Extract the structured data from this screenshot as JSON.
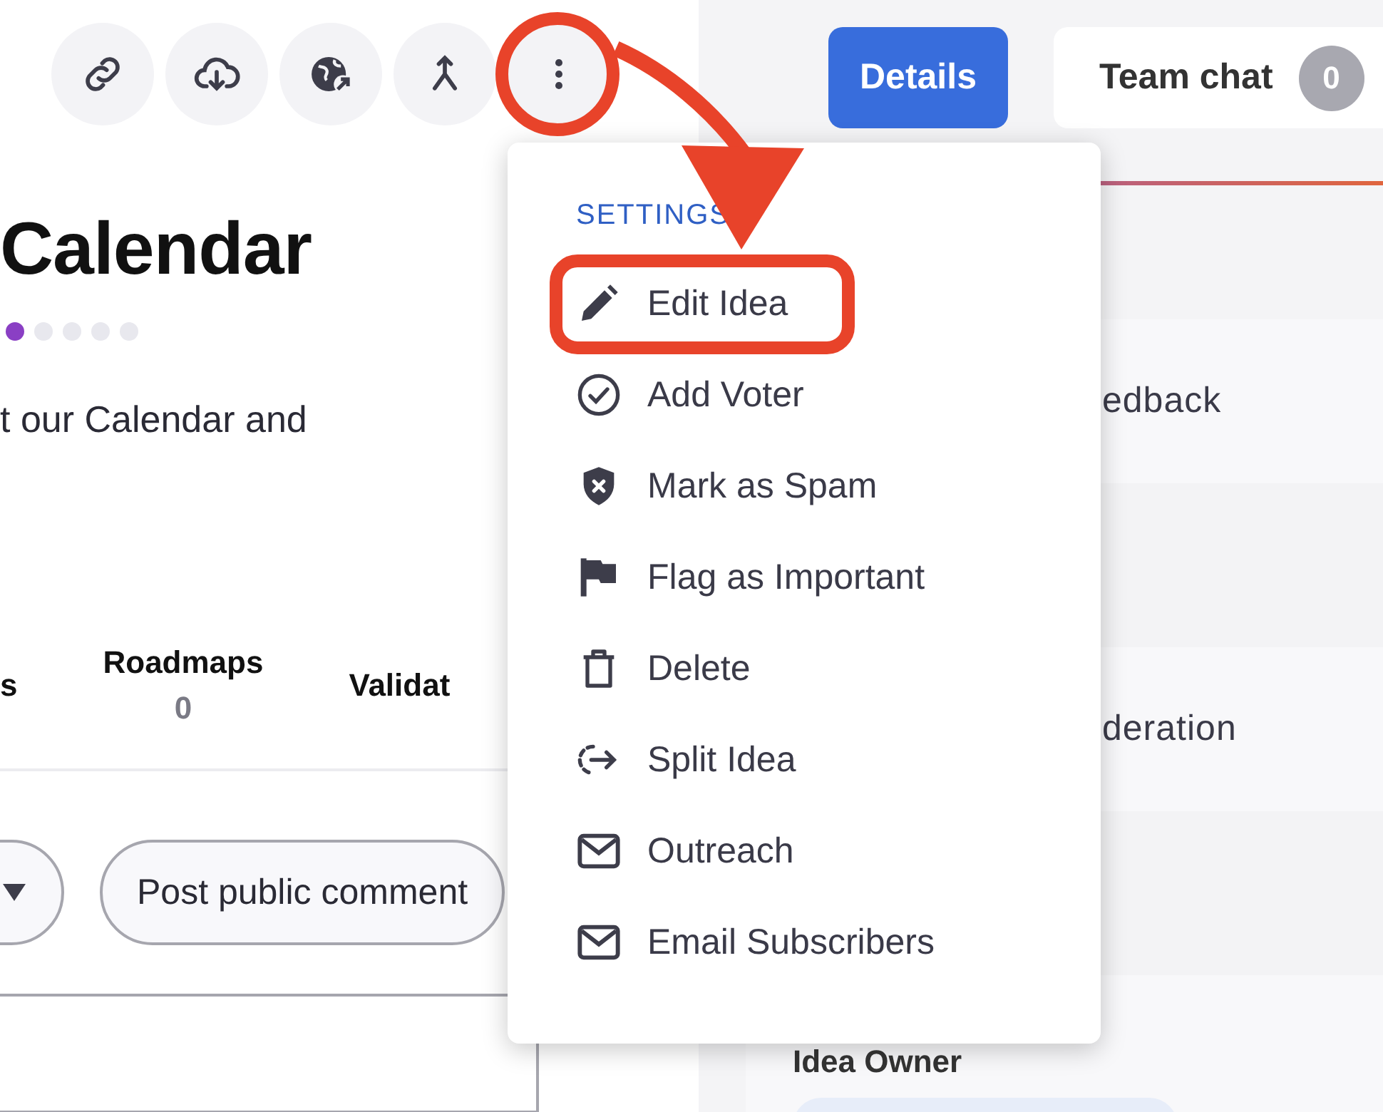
{
  "idea": {
    "title": "Calendar",
    "progress_dots": [
      {
        "filled": true
      },
      {
        "filled": false
      },
      {
        "filled": false
      },
      {
        "filled": false
      },
      {
        "filled": false
      }
    ],
    "description": "t our Calendar and",
    "stats": [
      {
        "label": "s"
      },
      {
        "label": "Roadmaps",
        "value": "0"
      },
      {
        "label": "Validat"
      }
    ],
    "comment_button": "Post public comment"
  },
  "tabs": [
    {
      "label": "Details",
      "selected": true
    },
    {
      "label": "Team chat",
      "selected": false,
      "count": "0"
    }
  ],
  "side_rows": [
    {
      "text": "edback"
    },
    {
      "text": "deration"
    }
  ],
  "owner": {
    "label": "Idea Owner"
  },
  "menu": {
    "section": "SETTINGS",
    "items": [
      "Edit Idea",
      "Add Voter",
      "Mark as Spam",
      "Flag as Important",
      "Delete",
      "Split Idea",
      "Outreach",
      "Email Subscribers"
    ]
  }
}
